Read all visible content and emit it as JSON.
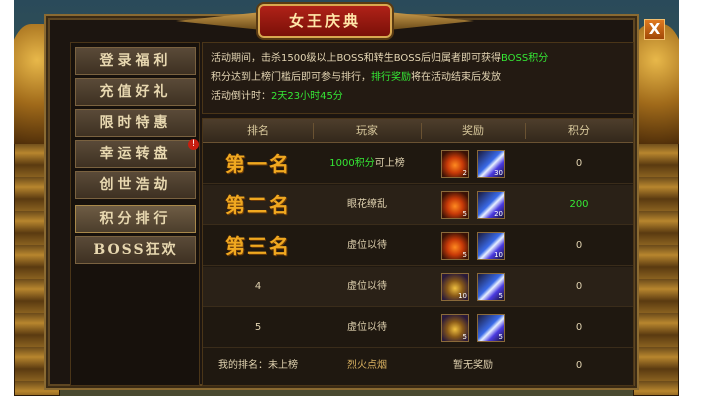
{
  "window": {
    "title": "女王庆典",
    "close_label": "X"
  },
  "sidebar": {
    "items": [
      {
        "label": "登录福利"
      },
      {
        "label": "充值好礼"
      },
      {
        "label": "限时特惠"
      },
      {
        "label": "幸运转盘"
      },
      {
        "label": "创世浩劫"
      },
      {
        "label": "积分排行"
      },
      {
        "label": "BOSS狂欢"
      }
    ],
    "badge": "!"
  },
  "info": {
    "line1_a": "活动期间，击杀1500级以上BOSS和转生BOSS后归属者即可获得",
    "line1_b": "BOSS积分",
    "line2_a": "积分达到上榜门槛后即可参与排行，",
    "line2_b": "排行奖励",
    "line2_c": "将在活动结束后发放",
    "line3_a": "活动倒计时：",
    "line3_b": "2天23小时45分"
  },
  "table": {
    "headers": {
      "rank": "排名",
      "player": "玩家",
      "reward": "奖励",
      "score": "积分"
    },
    "rows": [
      {
        "rank": "第一名",
        "player_a": "1000积分",
        "player_b": "可上榜",
        "rewards": [
          {
            "icon": "potion-icon",
            "count": "2"
          },
          {
            "icon": "crystal-icon",
            "count": "30"
          }
        ],
        "score": "0"
      },
      {
        "rank": "第二名",
        "player": "眼花缭乱",
        "rewards": [
          {
            "icon": "potion-icon",
            "count": "5"
          },
          {
            "icon": "crystal-icon",
            "count": "20"
          }
        ],
        "score": "200"
      },
      {
        "rank": "第三名",
        "player": "虚位以待",
        "rewards": [
          {
            "icon": "potion-icon",
            "count": "5"
          },
          {
            "icon": "crystal-icon",
            "count": "10"
          }
        ],
        "score": "0"
      },
      {
        "rank": "4",
        "player": "虚位以待",
        "rewards": [
          {
            "icon": "chest-icon",
            "count": "10"
          },
          {
            "icon": "crystal-icon",
            "count": "5"
          }
        ],
        "score": "0"
      },
      {
        "rank": "5",
        "player": "虚位以待",
        "rewards": [
          {
            "icon": "chest-icon",
            "count": "5"
          },
          {
            "icon": "crystal-icon",
            "count": "5"
          }
        ],
        "score": "0"
      }
    ],
    "my_rank": {
      "rank": "我的排名：未上榜",
      "player": "烈火点烟",
      "reward": "暂无奖励",
      "score": "0"
    }
  },
  "colors": {
    "highlight": "#35e835",
    "rank_gold": "#f0a820",
    "title_red": "#b02218"
  }
}
